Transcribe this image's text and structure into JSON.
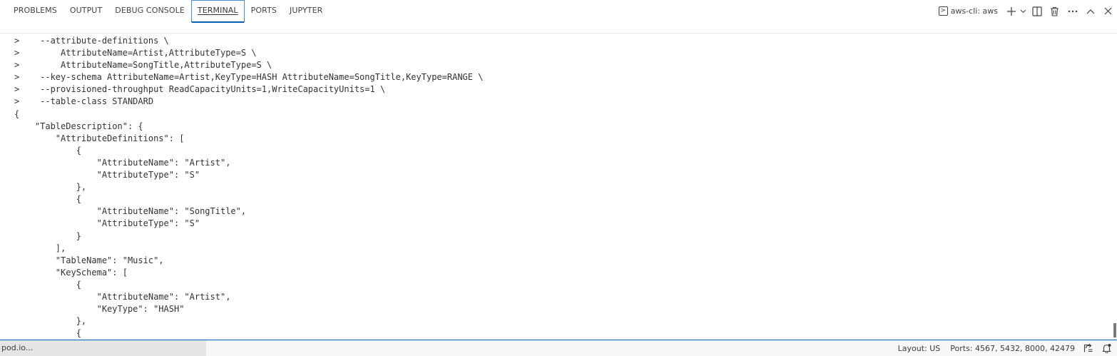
{
  "panel": {
    "tabs": [
      {
        "label": "PROBLEMS"
      },
      {
        "label": "OUTPUT"
      },
      {
        "label": "DEBUG CONSOLE"
      },
      {
        "label": "TERMINAL"
      },
      {
        "label": "PORTS"
      },
      {
        "label": "JUPYTER"
      }
    ],
    "active_tab": "TERMINAL",
    "terminal_selector": {
      "label": "aws-cli: aws",
      "icon": "terminal-icon"
    },
    "actions": [
      "plus-icon",
      "chevron-down-icon",
      "split-terminal-icon",
      "trash-icon",
      "more-icon",
      "chevron-up-icon",
      "close-icon"
    ]
  },
  "terminal": {
    "lines": [
      ">    --attribute-definitions \\",
      ">        AttributeName=Artist,AttributeType=S \\",
      ">        AttributeName=SongTitle,AttributeType=S \\",
      ">    --key-schema AttributeName=Artist,KeyType=HASH AttributeName=SongTitle,KeyType=RANGE \\",
      ">    --provisioned-throughput ReadCapacityUnits=1,WriteCapacityUnits=1 \\",
      ">    --table-class STANDARD",
      "{",
      "    \"TableDescription\": {",
      "        \"AttributeDefinitions\": [",
      "            {",
      "                \"AttributeName\": \"Artist\",",
      "                \"AttributeType\": \"S\"",
      "            },",
      "            {",
      "                \"AttributeName\": \"SongTitle\",",
      "                \"AttributeType\": \"S\"",
      "            }",
      "        ],",
      "        \"TableName\": \"Music\",",
      "        \"KeySchema\": [",
      "            {",
      "                \"AttributeName\": \"Artist\",",
      "                \"KeyType\": \"HASH\"",
      "            },",
      "            {"
    ]
  },
  "statusbar": {
    "remote": "pod.io...",
    "layout": "Layout: US",
    "ports": "Ports: 4567, 5432, 8000, 42479",
    "icons": [
      "live-share-icon",
      "notifications-icon"
    ]
  },
  "colors": {
    "accent": "#005fb8",
    "text": "#333333",
    "background": "#ffffff",
    "statusbar_bg": "#f8f8f8",
    "remote_bg": "#e5e5e5"
  }
}
